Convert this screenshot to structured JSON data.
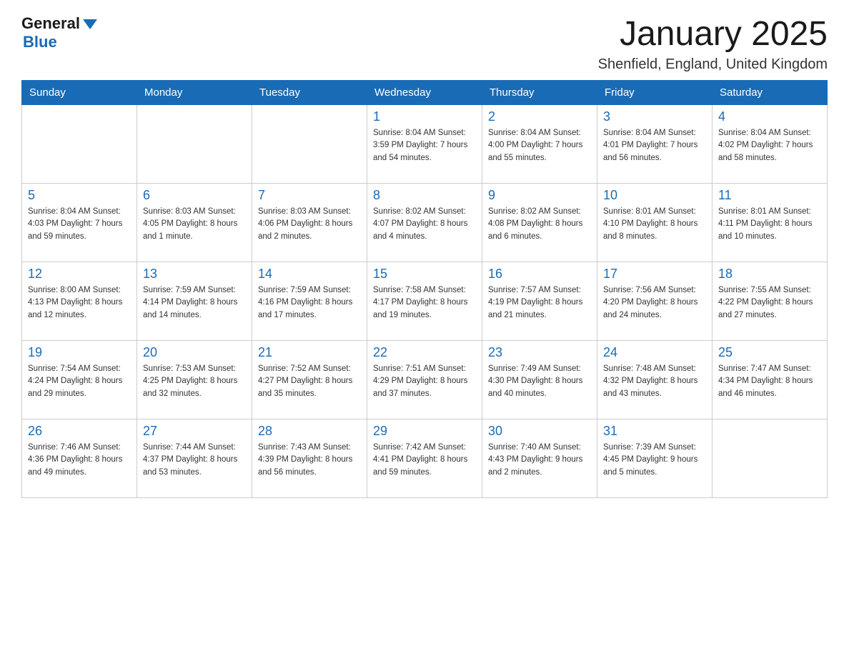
{
  "logo": {
    "general": "General",
    "blue": "Blue"
  },
  "title": "January 2025",
  "location": "Shenfield, England, United Kingdom",
  "weekdays": [
    "Sunday",
    "Monday",
    "Tuesday",
    "Wednesday",
    "Thursday",
    "Friday",
    "Saturday"
  ],
  "weeks": [
    [
      {
        "day": "",
        "info": ""
      },
      {
        "day": "",
        "info": ""
      },
      {
        "day": "",
        "info": ""
      },
      {
        "day": "1",
        "info": "Sunrise: 8:04 AM\nSunset: 3:59 PM\nDaylight: 7 hours\nand 54 minutes."
      },
      {
        "day": "2",
        "info": "Sunrise: 8:04 AM\nSunset: 4:00 PM\nDaylight: 7 hours\nand 55 minutes."
      },
      {
        "day": "3",
        "info": "Sunrise: 8:04 AM\nSunset: 4:01 PM\nDaylight: 7 hours\nand 56 minutes."
      },
      {
        "day": "4",
        "info": "Sunrise: 8:04 AM\nSunset: 4:02 PM\nDaylight: 7 hours\nand 58 minutes."
      }
    ],
    [
      {
        "day": "5",
        "info": "Sunrise: 8:04 AM\nSunset: 4:03 PM\nDaylight: 7 hours\nand 59 minutes."
      },
      {
        "day": "6",
        "info": "Sunrise: 8:03 AM\nSunset: 4:05 PM\nDaylight: 8 hours\nand 1 minute."
      },
      {
        "day": "7",
        "info": "Sunrise: 8:03 AM\nSunset: 4:06 PM\nDaylight: 8 hours\nand 2 minutes."
      },
      {
        "day": "8",
        "info": "Sunrise: 8:02 AM\nSunset: 4:07 PM\nDaylight: 8 hours\nand 4 minutes."
      },
      {
        "day": "9",
        "info": "Sunrise: 8:02 AM\nSunset: 4:08 PM\nDaylight: 8 hours\nand 6 minutes."
      },
      {
        "day": "10",
        "info": "Sunrise: 8:01 AM\nSunset: 4:10 PM\nDaylight: 8 hours\nand 8 minutes."
      },
      {
        "day": "11",
        "info": "Sunrise: 8:01 AM\nSunset: 4:11 PM\nDaylight: 8 hours\nand 10 minutes."
      }
    ],
    [
      {
        "day": "12",
        "info": "Sunrise: 8:00 AM\nSunset: 4:13 PM\nDaylight: 8 hours\nand 12 minutes."
      },
      {
        "day": "13",
        "info": "Sunrise: 7:59 AM\nSunset: 4:14 PM\nDaylight: 8 hours\nand 14 minutes."
      },
      {
        "day": "14",
        "info": "Sunrise: 7:59 AM\nSunset: 4:16 PM\nDaylight: 8 hours\nand 17 minutes."
      },
      {
        "day": "15",
        "info": "Sunrise: 7:58 AM\nSunset: 4:17 PM\nDaylight: 8 hours\nand 19 minutes."
      },
      {
        "day": "16",
        "info": "Sunrise: 7:57 AM\nSunset: 4:19 PM\nDaylight: 8 hours\nand 21 minutes."
      },
      {
        "day": "17",
        "info": "Sunrise: 7:56 AM\nSunset: 4:20 PM\nDaylight: 8 hours\nand 24 minutes."
      },
      {
        "day": "18",
        "info": "Sunrise: 7:55 AM\nSunset: 4:22 PM\nDaylight: 8 hours\nand 27 minutes."
      }
    ],
    [
      {
        "day": "19",
        "info": "Sunrise: 7:54 AM\nSunset: 4:24 PM\nDaylight: 8 hours\nand 29 minutes."
      },
      {
        "day": "20",
        "info": "Sunrise: 7:53 AM\nSunset: 4:25 PM\nDaylight: 8 hours\nand 32 minutes."
      },
      {
        "day": "21",
        "info": "Sunrise: 7:52 AM\nSunset: 4:27 PM\nDaylight: 8 hours\nand 35 minutes."
      },
      {
        "day": "22",
        "info": "Sunrise: 7:51 AM\nSunset: 4:29 PM\nDaylight: 8 hours\nand 37 minutes."
      },
      {
        "day": "23",
        "info": "Sunrise: 7:49 AM\nSunset: 4:30 PM\nDaylight: 8 hours\nand 40 minutes."
      },
      {
        "day": "24",
        "info": "Sunrise: 7:48 AM\nSunset: 4:32 PM\nDaylight: 8 hours\nand 43 minutes."
      },
      {
        "day": "25",
        "info": "Sunrise: 7:47 AM\nSunset: 4:34 PM\nDaylight: 8 hours\nand 46 minutes."
      }
    ],
    [
      {
        "day": "26",
        "info": "Sunrise: 7:46 AM\nSunset: 4:36 PM\nDaylight: 8 hours\nand 49 minutes."
      },
      {
        "day": "27",
        "info": "Sunrise: 7:44 AM\nSunset: 4:37 PM\nDaylight: 8 hours\nand 53 minutes."
      },
      {
        "day": "28",
        "info": "Sunrise: 7:43 AM\nSunset: 4:39 PM\nDaylight: 8 hours\nand 56 minutes."
      },
      {
        "day": "29",
        "info": "Sunrise: 7:42 AM\nSunset: 4:41 PM\nDaylight: 8 hours\nand 59 minutes."
      },
      {
        "day": "30",
        "info": "Sunrise: 7:40 AM\nSunset: 4:43 PM\nDaylight: 9 hours\nand 2 minutes."
      },
      {
        "day": "31",
        "info": "Sunrise: 7:39 AM\nSunset: 4:45 PM\nDaylight: 9 hours\nand 5 minutes."
      },
      {
        "day": "",
        "info": ""
      }
    ]
  ]
}
